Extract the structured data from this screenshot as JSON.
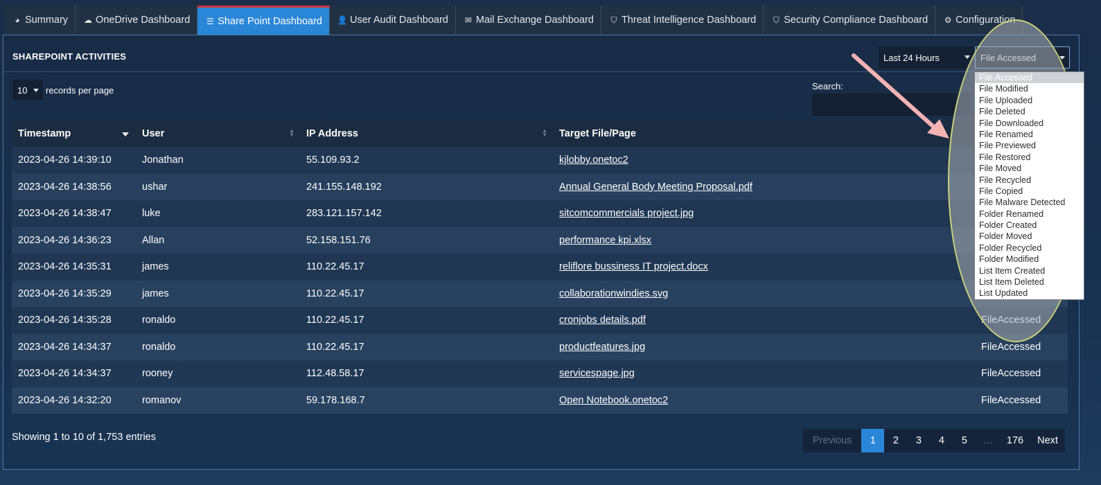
{
  "tabs": [
    {
      "icon": "dashboard-icon",
      "glyph": "◕",
      "label": "Summary",
      "active": false
    },
    {
      "icon": "cloud-icon",
      "glyph": "☁",
      "label": "OneDrive Dashboard",
      "active": false
    },
    {
      "icon": "list-icon",
      "glyph": "☰",
      "label": "Share Point Dashboard",
      "active": true
    },
    {
      "icon": "user-icon",
      "glyph": "👤",
      "label": "User Audit Dashboard",
      "active": false
    },
    {
      "icon": "envelope-icon",
      "glyph": "✉",
      "label": "Mail Exchange Dashboard",
      "active": false
    },
    {
      "icon": "shield-icon",
      "glyph": "⛉",
      "label": "Threat Intelligence Dashboard",
      "active": false
    },
    {
      "icon": "shield-icon",
      "glyph": "⛉",
      "label": "Security Compliance Dashboard",
      "active": false
    },
    {
      "icon": "gear-icon",
      "glyph": "⚙",
      "label": "Configuration",
      "active": false
    }
  ],
  "panel": {
    "title": "SHAREPOINT ACTIVITIES",
    "time_filter": "Last 24 Hours",
    "activity_filter": "File Accessed"
  },
  "records": {
    "value": "10",
    "label": "records per page"
  },
  "search": {
    "label": "Search:"
  },
  "table": {
    "headers": [
      "Timestamp",
      "User",
      "IP Address",
      "Target File/Page"
    ],
    "rows": [
      {
        "timestamp": "2023-04-26 14:39:10",
        "user": "Jonathan",
        "ip": "55.109.93.2",
        "target": "kjlobby.onetoc2",
        "activity": ""
      },
      {
        "timestamp": "2023-04-26 14:38:56",
        "user": "ushar",
        "ip": "241.155.148.192",
        "target": "Annual General Body Meeting Proposal.pdf",
        "activity": ""
      },
      {
        "timestamp": "2023-04-26 14:38:47",
        "user": "luke",
        "ip": "283.121.157.142",
        "target": "sitcomcommercials project.jpg",
        "activity": ""
      },
      {
        "timestamp": "2023-04-26 14:36:23",
        "user": "Allan",
        "ip": "52.158.151.76",
        "target": "performance kpi.xlsx",
        "activity": ""
      },
      {
        "timestamp": "2023-04-26 14:35:31",
        "user": "james",
        "ip": "110.22.45.17",
        "target": "reliflore bussiness IT project.docx",
        "activity": ""
      },
      {
        "timestamp": "2023-04-26 14:35:29",
        "user": "james",
        "ip": "110.22.45.17",
        "target": "collaborationwindies.svg",
        "activity": ""
      },
      {
        "timestamp": "2023-04-26 14:35:28",
        "user": "ronaldo",
        "ip": "110.22.45.17",
        "target": "cronjobs details.pdf",
        "activity": "FileAccessed"
      },
      {
        "timestamp": "2023-04-26 14:34:37",
        "user": "ronaldo",
        "ip": "110.22.45.17",
        "target": "productfeatures.jpg",
        "activity": "FileAccessed"
      },
      {
        "timestamp": "2023-04-26 14:34:37",
        "user": "rooney",
        "ip": "112.48.58.17",
        "target": "servicespage.jpg",
        "activity": "FileAccessed"
      },
      {
        "timestamp": "2023-04-26 14:32:20",
        "user": "romanov",
        "ip": "59.178.168.7",
        "target": "Open Notebook.onetoc2",
        "activity": "FileAccessed"
      }
    ]
  },
  "footer": {
    "info": "Showing 1 to 10 of 1,753 entries"
  },
  "pagination": {
    "previous": "Previous",
    "pages": [
      "1",
      "2",
      "3",
      "4",
      "5",
      "…",
      "176"
    ],
    "current": "1",
    "next": "Next"
  },
  "dropdown": {
    "options": [
      "File Accessed",
      "File Modified",
      "File Uploaded",
      "File Deleted",
      "File Downloaded",
      "File Renamed",
      "File Previewed",
      "File Restored",
      "File Moved",
      "File Recycled",
      "File Copied",
      "File Malware Detected",
      "Folder Renamed",
      "Folder Created",
      "Folder Moved",
      "Folder Recycled",
      "Folder Modified",
      "List Item Created",
      "List Item Deleted",
      "List Updated"
    ],
    "selected": "File Accessed"
  },
  "colors": {
    "accent": "#2a86d7",
    "active_tab_top": "#d1353b",
    "annotation_arrow": "#f4b3b3",
    "annotation_oval_border": "#c9d27a"
  }
}
